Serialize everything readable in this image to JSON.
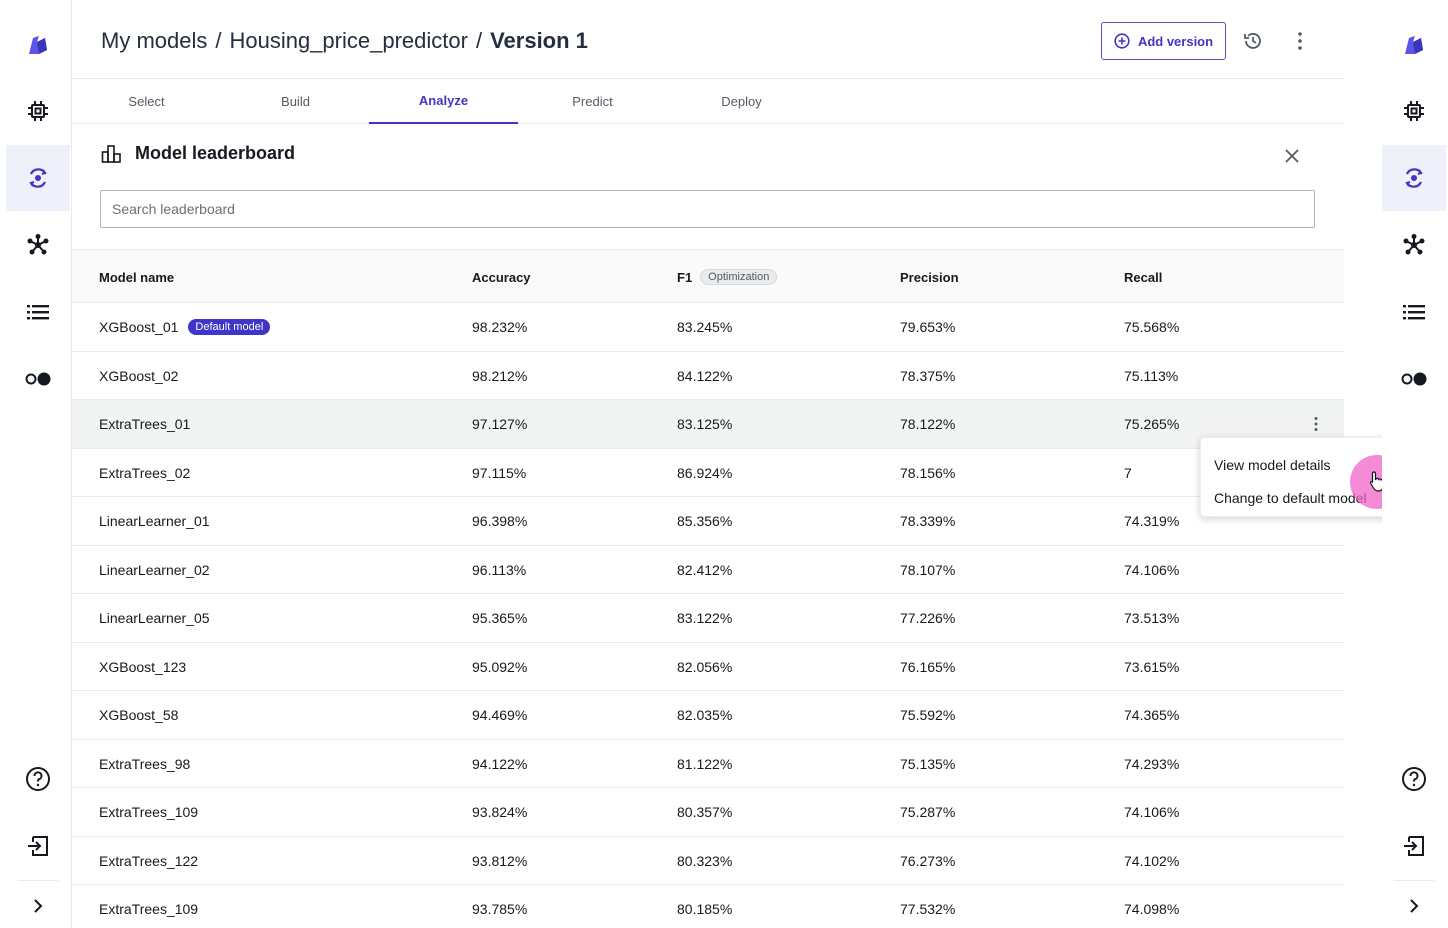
{
  "breadcrumb": {
    "root": "My models",
    "separator": "/",
    "model": "Housing_price_predictor",
    "current": "Version 1"
  },
  "header": {
    "add_version_label": "Add version",
    "history_icon": "history-icon",
    "more_icon": "more-vertical-icon"
  },
  "tabs": [
    {
      "label": "Select",
      "active": false
    },
    {
      "label": "Build",
      "active": false
    },
    {
      "label": "Analyze",
      "active": true
    },
    {
      "label": "Predict",
      "active": false
    },
    {
      "label": "Deploy",
      "active": false
    }
  ],
  "leaderboard": {
    "title": "Model leaderboard",
    "icon": "leaderboard-icon",
    "search_placeholder": "Search leaderboard",
    "search_value": "",
    "columns": {
      "name": "Model name",
      "accuracy": "Accuracy",
      "f1": "F1",
      "f1_badge": "Optimization",
      "precision": "Precision",
      "recall": "Recall"
    },
    "default_badge": "Default model",
    "rows": [
      {
        "name": "XGBoost_01",
        "accuracy": "98.232%",
        "f1": "83.245%",
        "precision": "79.653%",
        "recall": "75.568%",
        "default": true
      },
      {
        "name": "XGBoost_02",
        "accuracy": "98.212%",
        "f1": "84.122%",
        "precision": "78.375%",
        "recall": "75.113%"
      },
      {
        "name": "ExtraTrees_01",
        "accuracy": "97.127%",
        "f1": "83.125%",
        "precision": "78.122%",
        "recall": "75.265%",
        "hover": true
      },
      {
        "name": "ExtraTrees_02",
        "accuracy": "97.115%",
        "f1": "86.924%",
        "precision": "78.156%",
        "recall": "7"
      },
      {
        "name": "LinearLearner_01",
        "accuracy": "96.398%",
        "f1": "85.356%",
        "precision": "78.339%",
        "recall": "74.319%"
      },
      {
        "name": "LinearLearner_02",
        "accuracy": "96.113%",
        "f1": "82.412%",
        "precision": "78.107%",
        "recall": "74.106%"
      },
      {
        "name": "LinearLearner_05",
        "accuracy": "95.365%",
        "f1": "83.122%",
        "precision": "77.226%",
        "recall": "73.513%"
      },
      {
        "name": "XGBoost_123",
        "accuracy": "95.092%",
        "f1": "82.056%",
        "precision": "76.165%",
        "recall": "73.615%"
      },
      {
        "name": "XGBoost_58",
        "accuracy": "94.469%",
        "f1": "82.035%",
        "precision": "75.592%",
        "recall": "74.365%"
      },
      {
        "name": "ExtraTrees_98",
        "accuracy": "94.122%",
        "f1": "81.122%",
        "precision": "75.135%",
        "recall": "74.293%"
      },
      {
        "name": "ExtraTrees_109",
        "accuracy": "93.824%",
        "f1": "80.357%",
        "precision": "75.287%",
        "recall": "74.106%"
      },
      {
        "name": "ExtraTrees_122",
        "accuracy": "93.812%",
        "f1": "80.323%",
        "precision": "76.273%",
        "recall": "74.102%"
      },
      {
        "name": "ExtraTrees_109",
        "accuracy": "93.785%",
        "f1": "80.185%",
        "precision": "77.532%",
        "recall": "74.098%"
      }
    ]
  },
  "row_menu": {
    "items": [
      "View model details",
      "Change to default model"
    ]
  },
  "rail": {
    "items": [
      "logo-icon",
      "chip-icon",
      "models-icon",
      "nodes-icon",
      "list-icon",
      "toggle-icon"
    ],
    "active": "models-icon",
    "bottom": [
      "help-icon",
      "sign-out-icon",
      "chevron-right-icon"
    ]
  },
  "colors": {
    "accent": "#4335c4",
    "default_badge": "#3f36c9",
    "cursor_highlight": "#f264c8",
    "rail_active": "#eef0fa"
  }
}
